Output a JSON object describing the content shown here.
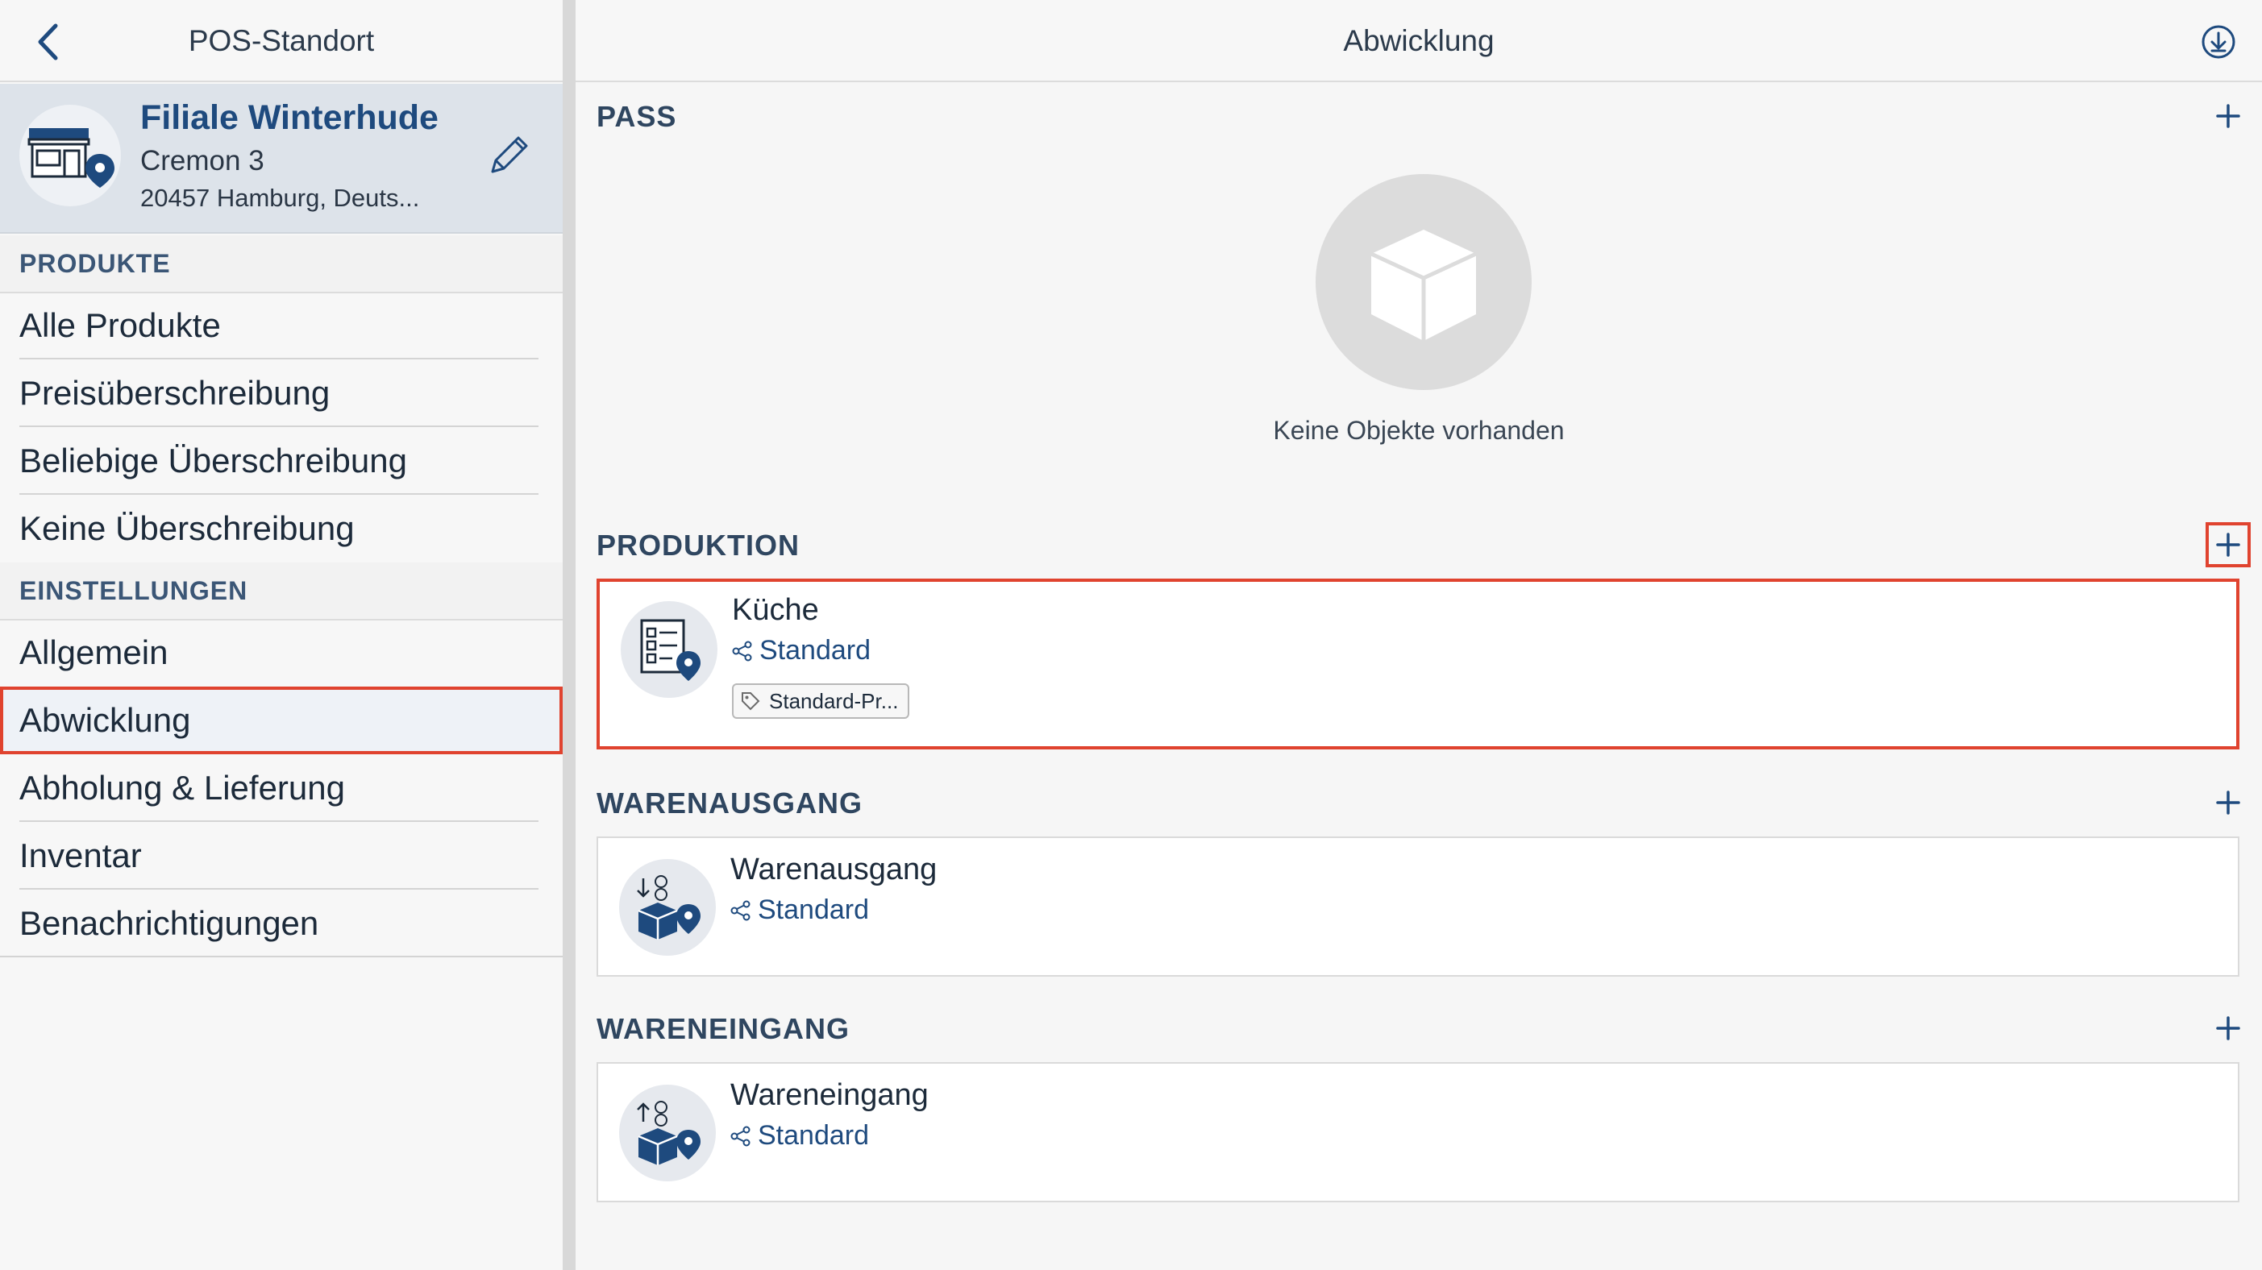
{
  "left": {
    "title": "POS-Standort",
    "store": {
      "name": "Filiale Winterhude",
      "street": "Cremon 3",
      "city": "20457 Hamburg, Deuts..."
    },
    "sections": [
      {
        "label": "PRODUKTE",
        "items": [
          "Alle Produkte",
          "Preisüberschreibung",
          "Beliebige Überschreibung",
          "Keine Überschreibung"
        ]
      },
      {
        "label": "EINSTELLUNGEN",
        "items": [
          "Allgemein",
          "Abwicklung",
          "Abholung & Lieferung",
          "Inventar",
          "Benachrichtigungen"
        ]
      }
    ],
    "active_item": "Abwicklung"
  },
  "right": {
    "title": "Abwicklung",
    "pass": {
      "label": "PASS",
      "empty_text": "Keine Objekte vorhanden"
    },
    "produktion": {
      "label": "PRODUKTION",
      "card": {
        "title": "Küche",
        "sub": "Standard",
        "tag": "Standard-Pr..."
      }
    },
    "warenausgang": {
      "label": "WARENAUSGANG",
      "card": {
        "title": "Warenausgang",
        "sub": "Standard"
      }
    },
    "wareneingang": {
      "label": "WARENEINGANG",
      "card": {
        "title": "Wareneingang",
        "sub": "Standard"
      }
    }
  },
  "colors": {
    "accent": "#1e4a7e",
    "highlight": "#e0432f",
    "section_text": "#3b5676"
  }
}
